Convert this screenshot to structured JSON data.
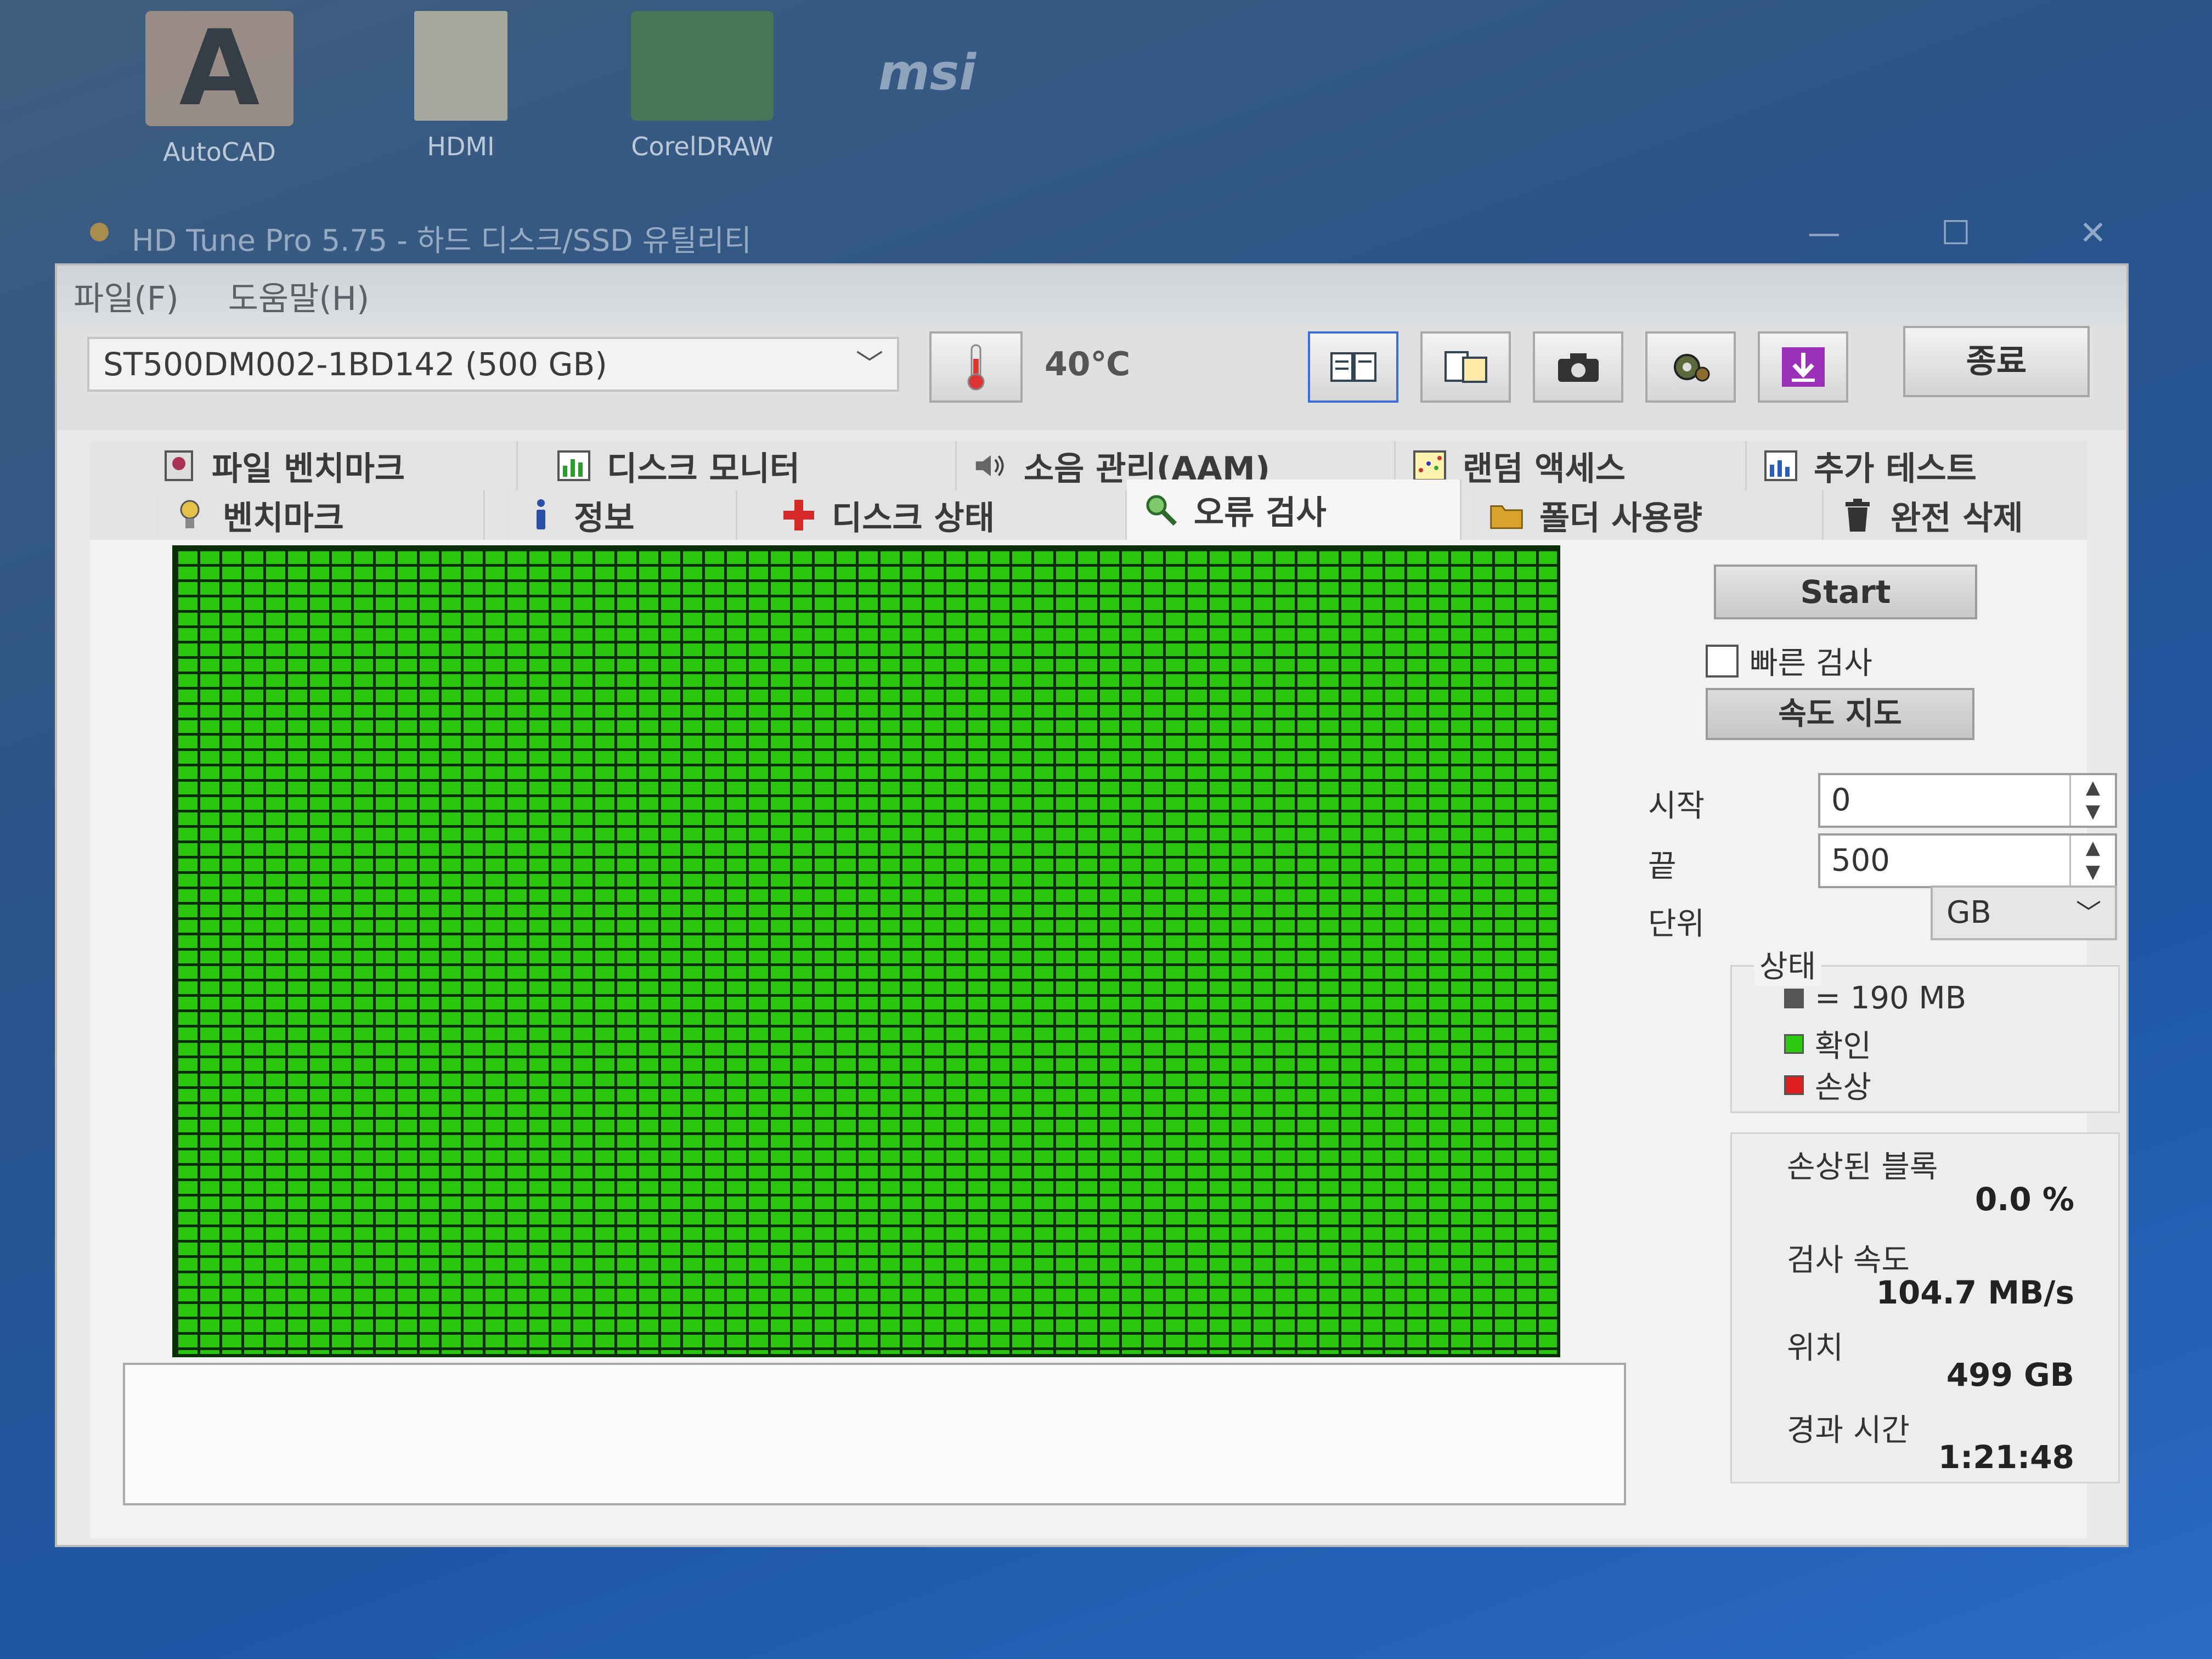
{
  "desktop": {
    "icons": [
      {
        "name": "autocad-icon",
        "label": "AutoCAD"
      },
      {
        "name": "file-icon",
        "label": "HDMI"
      },
      {
        "name": "coreldraw-icon",
        "label": "CorelDRAW"
      },
      {
        "name": "msi-icon",
        "label": "msi"
      }
    ]
  },
  "window": {
    "title": "HD Tune Pro 5.75 - 하드 디스크/SSD 유틸리티",
    "controls": {
      "minimize": "—",
      "maximize": "☐",
      "close": "✕"
    }
  },
  "menu": [
    {
      "label": "파일(F)"
    },
    {
      "label": "도움말(H)"
    }
  ],
  "toolbar": {
    "drive": "ST500DM002-1BD142 (500 GB)",
    "temperature": "40℃",
    "exit_label": "종료"
  },
  "tabs": {
    "row1": [
      {
        "label": "파일 벤치마크",
        "icon": "file-benchmark-icon"
      },
      {
        "label": "디스크 모니터",
        "icon": "disk-monitor-icon"
      },
      {
        "label": "소음 관리(AAM)",
        "icon": "speaker-icon"
      },
      {
        "label": "랜덤 액세스",
        "icon": "random-access-icon"
      },
      {
        "label": "추가 테스트",
        "icon": "extra-tests-icon"
      }
    ],
    "row2": [
      {
        "label": "벤치마크",
        "icon": "benchmark-icon"
      },
      {
        "label": "정보",
        "icon": "info-icon"
      },
      {
        "label": "디스크 상태",
        "icon": "health-cross-icon"
      },
      {
        "label": "오류 검사",
        "icon": "magnifier-icon",
        "active": true
      },
      {
        "label": "폴더 사용량",
        "icon": "folder-icon"
      },
      {
        "label": "완전 삭제",
        "icon": "trash-icon"
      }
    ]
  },
  "scan": {
    "start_label": "Start",
    "quick_scan_label": "빠른 검사",
    "quick_scan_checked": false,
    "speed_map_label": "속도 지도",
    "start_field_label": "시작",
    "start_value": "0",
    "end_field_label": "끝",
    "end_value": "500",
    "unit_label": "단위",
    "unit_value": "GB"
  },
  "legend": {
    "title": "상태",
    "items": [
      {
        "label": "= 190 MB",
        "color": "#555555"
      },
      {
        "label": "확인",
        "color": "#2bc80f"
      },
      {
        "label": "손상",
        "color": "#e02020"
      }
    ]
  },
  "stats": {
    "damaged_label": "손상된 블록",
    "damaged_value": "0.0 %",
    "speed_label": "검사 속도",
    "speed_value": "104.7 MB/s",
    "position_label": "위치",
    "position_value": "499 GB",
    "elapsed_label": "경과 시간",
    "elapsed_value": "1:21:48"
  },
  "colors": {
    "ok_block": "#29c80e",
    "grid_line": "#0a2e05",
    "active_toolbar_border": "#3c6fd6"
  }
}
